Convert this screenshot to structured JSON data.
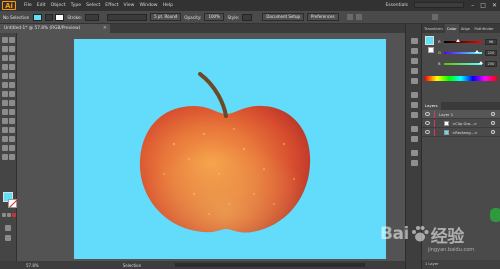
{
  "menubar": {
    "app_logo": "Ai",
    "menus": [
      "File",
      "Edit",
      "Object",
      "Type",
      "Select",
      "Effect",
      "View",
      "Window",
      "Help"
    ],
    "workspace": "Essentials",
    "window_controls": [
      "–",
      "□",
      "✕"
    ]
  },
  "controlbar": {
    "selection_label": "No Selection",
    "stroke_label": "Stroke:",
    "brush_label": "5 pt. Round",
    "opacity_label": "Opacity:",
    "opacity_value": "100%",
    "style_label": "Style:",
    "document_setup": "Document Setup",
    "preferences": "Preferences",
    "fill_color": "#5fe0f7"
  },
  "document_tab": {
    "title": "Untitled-1* @ 57.8% (RGB/Preview)",
    "close": "×"
  },
  "statusbar": {
    "zoom": "57.8%",
    "tool": "Selection"
  },
  "panels": {
    "top_tabs": [
      "Transform",
      "Color",
      "Align",
      "Pathfinder"
    ],
    "active_tab": "Color",
    "color_sliders": [
      {
        "label": "R",
        "value": "96",
        "fraction": 0.38,
        "track": "linear-gradient(to right, #000, #f00)"
      },
      {
        "label": "G",
        "value": "220",
        "fraction": 0.86,
        "track": "linear-gradient(to right, #5000ff, #60ffff)"
      },
      {
        "label": "B",
        "value": "250",
        "fraction": 0.98,
        "track": "linear-gradient(to right, #60c000, #60ffff)"
      }
    ],
    "layers_tab": "Layers",
    "layers": [
      {
        "name": "Layer 1"
      },
      {
        "name": "<Clip Gro...>"
      },
      {
        "name": "<Rectang...>"
      }
    ],
    "layers_count": "1 Layer"
  },
  "watermark": {
    "text_left": "Bai",
    "text_right": "经验",
    "url": "jingyan.baidu.com"
  },
  "artboard_color": "#62dcfa",
  "accent_color": "#ff9a00"
}
